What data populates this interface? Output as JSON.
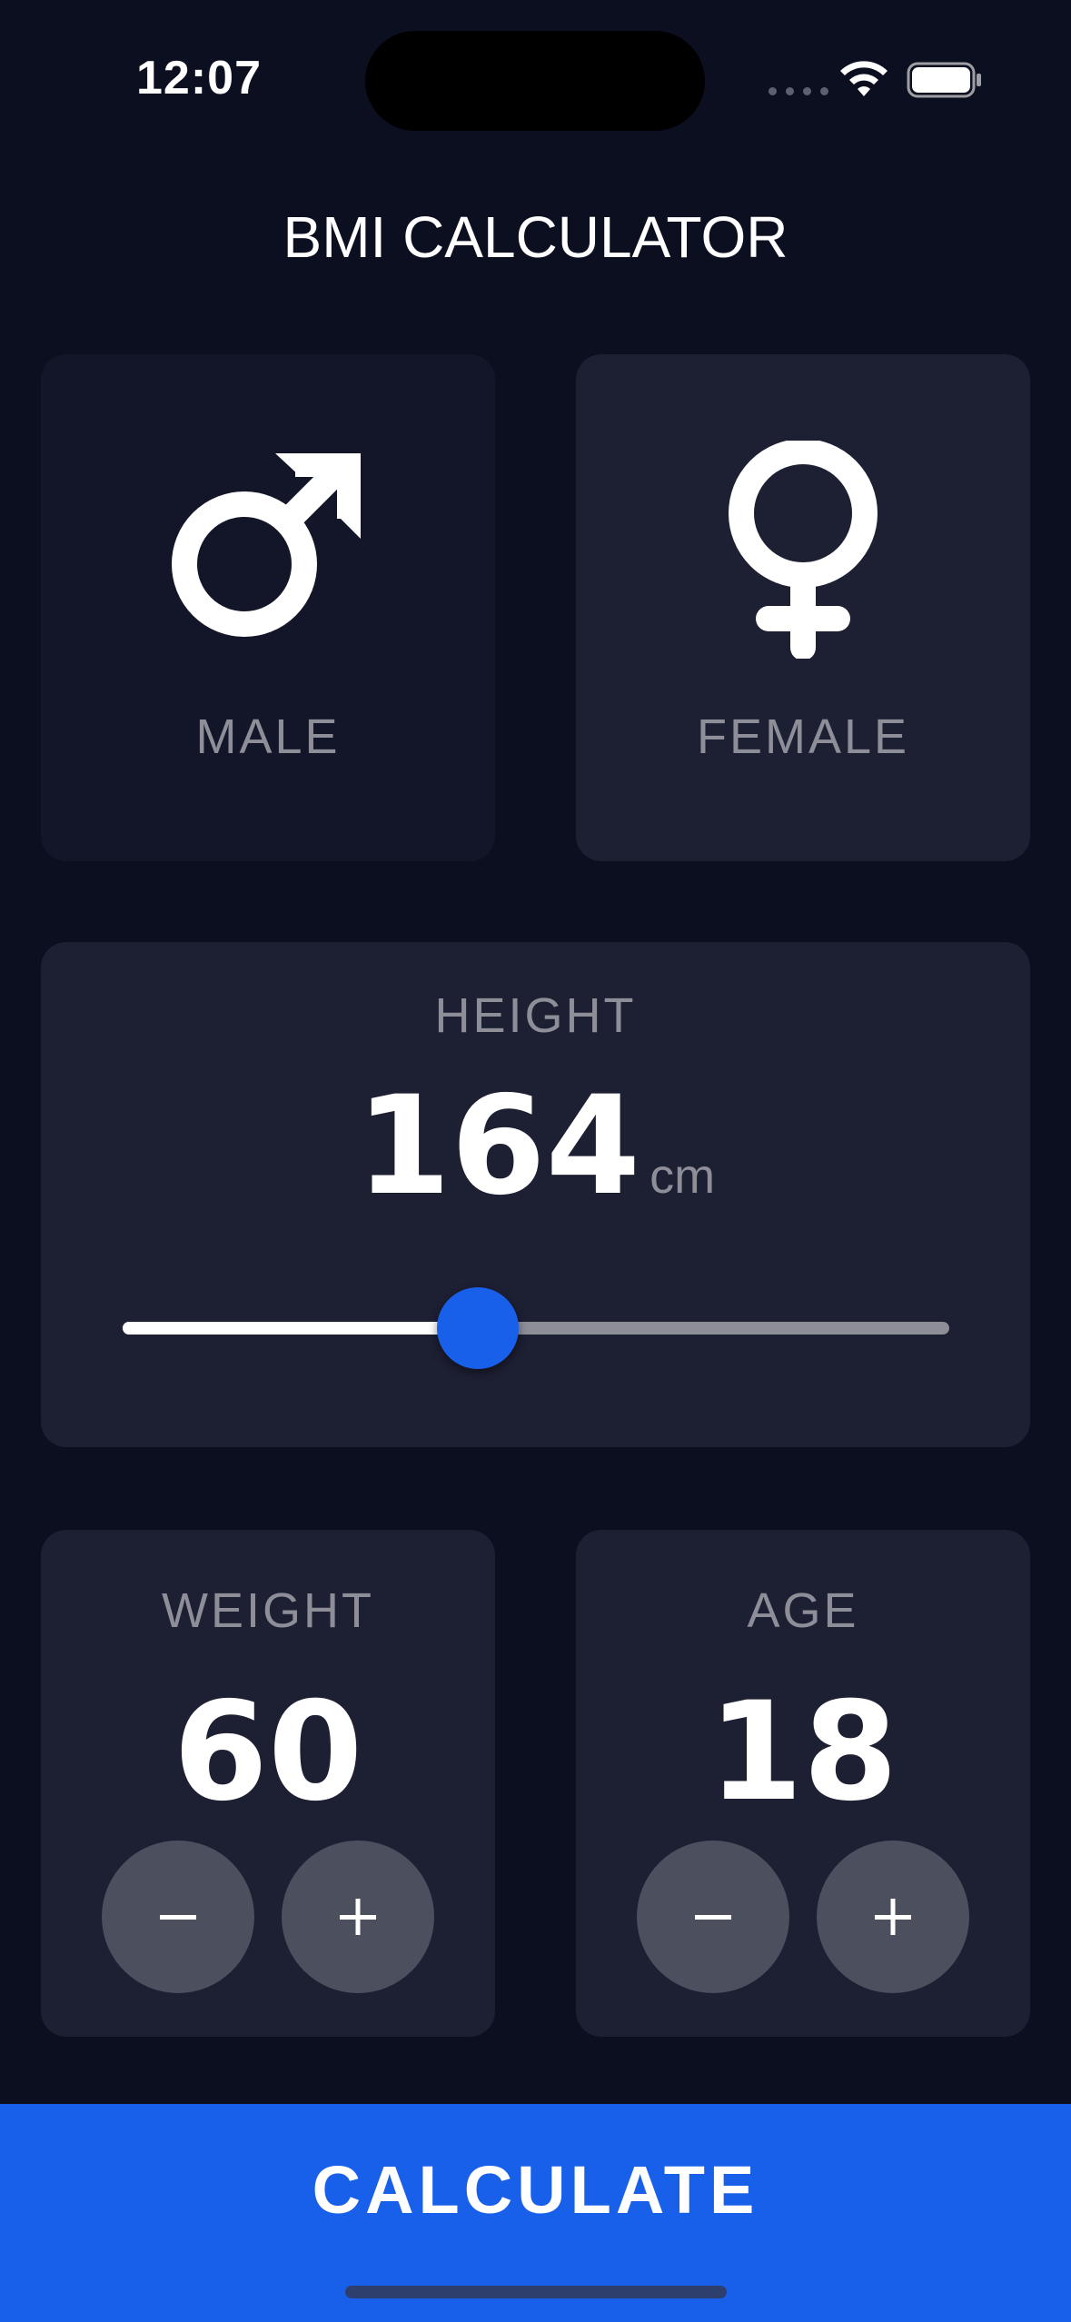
{
  "status_bar": {
    "time": "12:07",
    "wifi_icon": "wifi-icon",
    "battery_icon": "battery-icon"
  },
  "app": {
    "title": "BMI CALCULATOR"
  },
  "colors": {
    "background": "#0B0F20",
    "card_active": "#1D1F33",
    "card_inactive": "#131628",
    "label_gray": "#8D8E98",
    "accent_blue": "#1860E9",
    "round_button": "#4C4F5E"
  },
  "gender": {
    "male": {
      "label": "MALE",
      "icon": "male-symbol-icon",
      "selected": false
    },
    "female": {
      "label": "FEMALE",
      "icon": "female-symbol-icon",
      "selected": false
    }
  },
  "height": {
    "label": "HEIGHT",
    "value": "164",
    "unit": "cm",
    "slider_fraction": 0.43
  },
  "weight": {
    "label": "WEIGHT",
    "value": "60",
    "minus_icon": "minus-icon",
    "plus_icon": "plus-icon"
  },
  "age": {
    "label": "AGE",
    "value": "18",
    "minus_icon": "minus-icon",
    "plus_icon": "plus-icon"
  },
  "calculate": {
    "label": "CALCULATE"
  }
}
